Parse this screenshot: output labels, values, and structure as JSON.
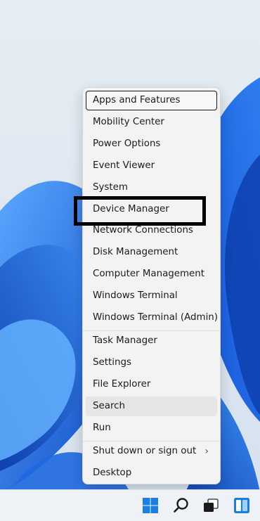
{
  "wallpaper": {
    "accent": "#1a6fe6",
    "deep": "#0a3fb0",
    "light": "#4f9dfa"
  },
  "context_menu": {
    "items": [
      {
        "label": "Apps and Features",
        "name": "menu-item-apps-and-features"
      },
      {
        "label": "Mobility Center",
        "name": "menu-item-mobility-center"
      },
      {
        "label": "Power Options",
        "name": "menu-item-power-options"
      },
      {
        "label": "Event Viewer",
        "name": "menu-item-event-viewer"
      },
      {
        "label": "System",
        "name": "menu-item-system"
      },
      {
        "label": "Device Manager",
        "name": "menu-item-device-manager"
      },
      {
        "label": "Network Connections",
        "name": "menu-item-network-connections"
      },
      {
        "label": "Disk Management",
        "name": "menu-item-disk-management"
      },
      {
        "label": "Computer Management",
        "name": "menu-item-computer-management"
      },
      {
        "label": "Windows Terminal",
        "name": "menu-item-windows-terminal"
      },
      {
        "label": "Windows Terminal (Admin)",
        "name": "menu-item-windows-terminal-admin"
      },
      {
        "label": "Task Manager",
        "name": "menu-item-task-manager"
      },
      {
        "label": "Settings",
        "name": "menu-item-settings"
      },
      {
        "label": "File Explorer",
        "name": "menu-item-file-explorer"
      },
      {
        "label": "Search",
        "name": "menu-item-search"
      },
      {
        "label": "Run",
        "name": "menu-item-run"
      },
      {
        "label": "Shut down or sign out",
        "name": "menu-item-shut-down-or-sign-out",
        "submenu": true
      },
      {
        "label": "Desktop",
        "name": "menu-item-desktop"
      }
    ],
    "submenu_glyph": "›",
    "focused_item": "Apps and Features",
    "hover_item": "Search",
    "annotated_item": "Device Manager"
  },
  "taskbar": {
    "icons": [
      "windows-start-icon",
      "search-icon",
      "task-view-icon",
      "widgets-icon"
    ],
    "start_color": "#1a7fe0"
  }
}
